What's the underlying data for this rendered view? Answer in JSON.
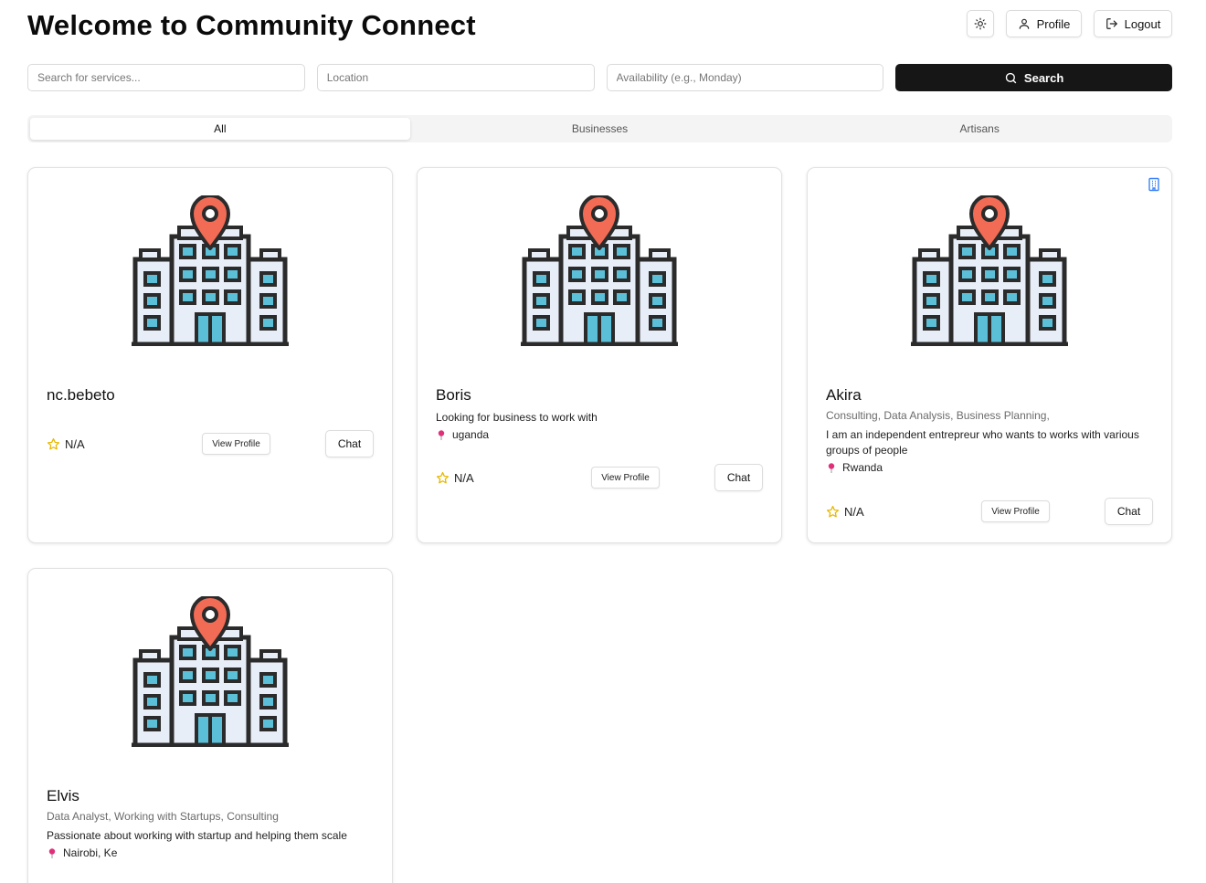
{
  "header": {
    "title": "Welcome to Community Connect",
    "profile_label": "Profile",
    "logout_label": "Logout"
  },
  "search": {
    "services_placeholder": "Search for services...",
    "location_placeholder": "Location",
    "availability_placeholder": "Availability (e.g., Monday)",
    "button_label": "Search"
  },
  "tabs": [
    {
      "label": "All",
      "active": true
    },
    {
      "label": "Businesses",
      "active": false
    },
    {
      "label": "Artisans",
      "active": false
    }
  ],
  "cards": [
    {
      "name": "nc.bebeto",
      "rating": "N/A",
      "view_label": "View Profile",
      "chat_label": "Chat"
    },
    {
      "name": "Boris",
      "description": "Looking for business to work with",
      "location": "uganda",
      "rating": "N/A",
      "view_label": "View Profile",
      "chat_label": "Chat"
    },
    {
      "name": "Akira",
      "tags": "Consulting, Data Analysis, Business Planning,",
      "description": "I am an independent entrepreur who wants to works with various groups of people",
      "location": "Rwanda",
      "rating": "N/A",
      "view_label": "View Profile",
      "chat_label": "Chat"
    },
    {
      "name": "Elvis",
      "tags": "Data Analyst, Working with Startups, Consulting",
      "description": "Passionate about working with startup and helping them scale",
      "location": "Nairobi, Ke"
    }
  ],
  "icons": {
    "theme": "sun-icon",
    "profile": "user-icon",
    "logout": "logout-icon",
    "search": "search-icon",
    "rating": "star-outline-icon",
    "location": "location-pin-icon",
    "business_badge": "building-icon",
    "card_illustration": "office-building-location-icon"
  },
  "colors": {
    "search_button": "#161616",
    "star": "#e6b800",
    "location_pin": "#e0307a",
    "building_badge": "#3b82f6",
    "map_marker": "#f26b55",
    "window_fill": "#5bbfd8"
  }
}
